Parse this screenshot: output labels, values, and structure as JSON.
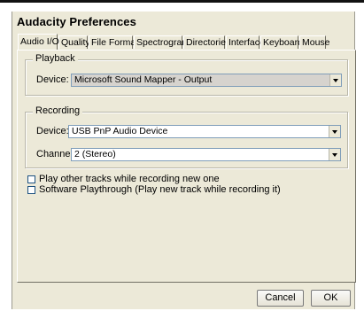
{
  "window": {
    "title": "Audacity Preferences"
  },
  "tabs": [
    {
      "label": "Audio I/O",
      "active": true
    },
    {
      "label": "Quality"
    },
    {
      "label": "File Formats"
    },
    {
      "label": "Spectrograms"
    },
    {
      "label": "Directories"
    },
    {
      "label": "Interface"
    },
    {
      "label": "Keyboard"
    },
    {
      "label": "Mouse"
    }
  ],
  "playback": {
    "legend": "Playback",
    "device_label": "Device:",
    "device_value": "Microsoft Sound Mapper - Output"
  },
  "recording": {
    "legend": "Recording",
    "device_label": "Device:",
    "device_value": "USB PnP Audio Device",
    "channels_label": "Channels:",
    "channels_value": "2 (Stereo)"
  },
  "options": {
    "play_other_tracks": "Play other tracks while recording new one",
    "software_playthrough": "Software Playthrough (Play new track while recording it)"
  },
  "buttons": {
    "cancel": "Cancel",
    "ok": "OK"
  }
}
